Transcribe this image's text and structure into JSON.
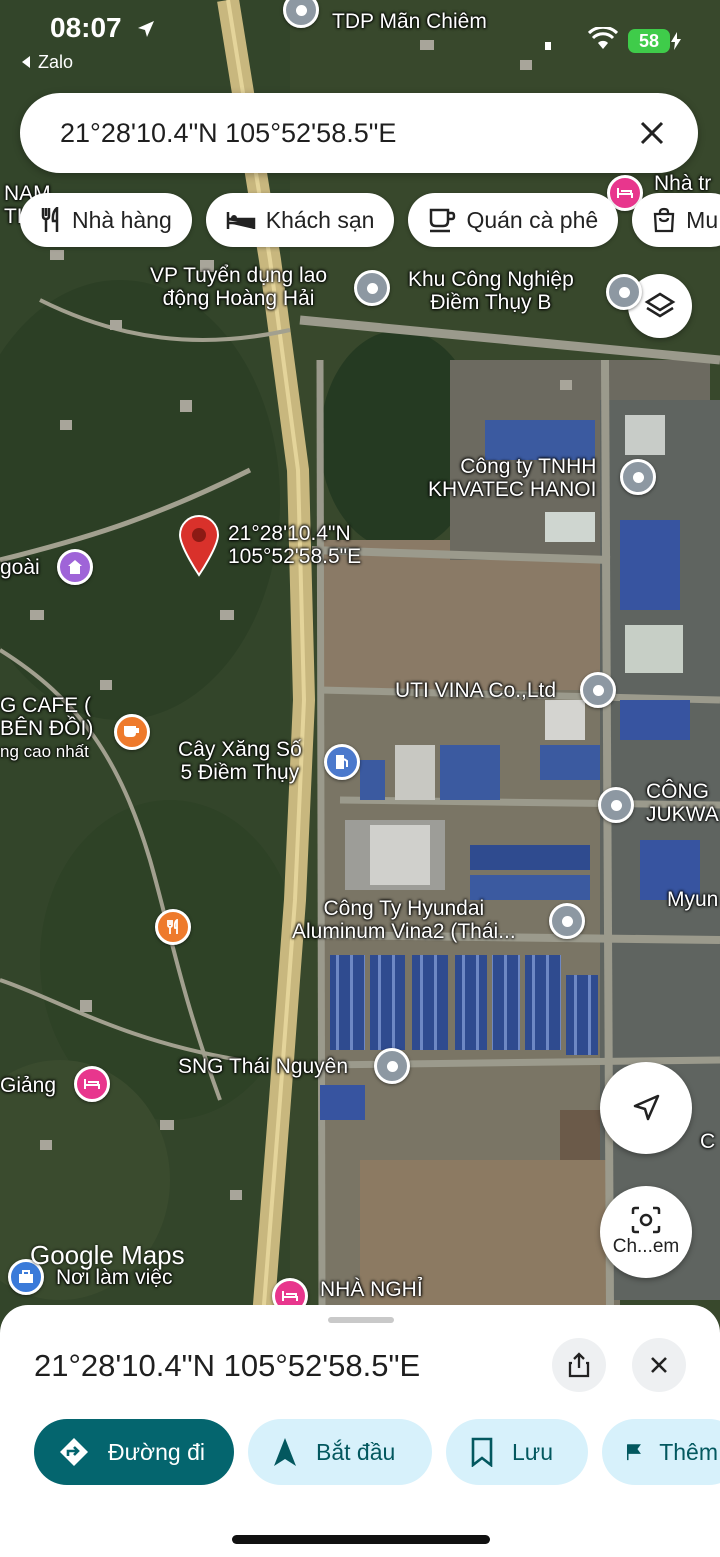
{
  "status": {
    "time": "08:07",
    "back_app": "Zalo",
    "battery": "58"
  },
  "search": {
    "query": "21°28'10.4\"N 105°52'58.5\"E"
  },
  "chips": [
    {
      "label": "Nhà hàng",
      "icon": "fork-knife-icon"
    },
    {
      "label": "Khách sạn",
      "icon": "bed-icon"
    },
    {
      "label": "Quán cà phê",
      "icon": "coffee-cup-icon"
    },
    {
      "label": "Mu",
      "icon": "shopping-bag-icon"
    }
  ],
  "map": {
    "labels": {
      "tdp": [
        "TDP Mãn Chiêm"
      ],
      "nam": [
        "NAM",
        "TH"
      ],
      "nha_tr": [
        "Nhà tr"
      ],
      "vp": [
        "VP Tuyển dụng lao",
        "động Hoàng Hải"
      ],
      "kcn": [
        "Khu Công Nghiệp",
        "Điềm Thụy B"
      ],
      "khvatec": [
        "Công ty TNHH",
        "KHVATEC HANOI"
      ],
      "pin": [
        "21°28'10.4\"N",
        "105°52'58.5\"E"
      ],
      "ngoai": [
        "goài"
      ],
      "cafe": [
        "G CAFE (",
        "BÊN ĐỒI)",
        "ng cao nhất"
      ],
      "uti": [
        "UTI VINA Co.,Ltd"
      ],
      "xang": [
        "Cây Xăng Số",
        "5 Điềm Thụy"
      ],
      "cong": [
        "CÔNG",
        "JUKWA"
      ],
      "myun": [
        "Myun"
      ],
      "hyundai": [
        "Công Ty Hyundai",
        "Aluminum Vina2 (Thái..."
      ],
      "sng": [
        "SNG Thái Nguyên"
      ],
      "giang": [
        "Giảng"
      ],
      "c_edge": [
        "C"
      ],
      "noi_lam": [
        "Nơi làm việc"
      ],
      "nha_nghi": [
        "NHÀ NGHỈ"
      ]
    },
    "watermark": "Google Maps",
    "camera_label": "Ch...em"
  },
  "place": {
    "title": "21°28'10.4\"N 105°52'58.5\"E"
  },
  "actions": [
    {
      "label": "Đường đi",
      "icon": "directions-icon"
    },
    {
      "label": "Bắt đầu",
      "icon": "navigation-arrow-icon"
    },
    {
      "label": "Lưu",
      "icon": "bookmark-icon"
    },
    {
      "label": "Thêm",
      "icon": "flag-icon"
    }
  ],
  "colors": {
    "primary_action": "#04656e",
    "secondary_action": "#d7f1fb",
    "pin": "#d9312b"
  }
}
